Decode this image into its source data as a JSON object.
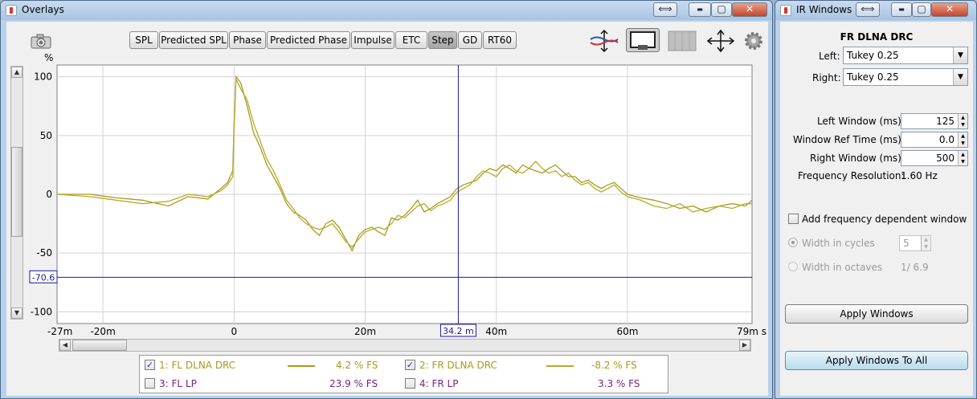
{
  "overlays_window": {
    "title": "Overlays",
    "controls": {
      "restore": "⟺",
      "minimize": "▬",
      "maximize": "▢",
      "close": "✕"
    },
    "tabs": [
      {
        "label": "SPL",
        "active": false
      },
      {
        "label": "Predicted SPL",
        "active": false
      },
      {
        "label": "Phase",
        "active": false
      },
      {
        "label": "Predicted Phase",
        "active": false
      },
      {
        "label": "Impulse",
        "active": false
      },
      {
        "label": "ETC",
        "active": false
      },
      {
        "label": "Step",
        "active": true
      },
      {
        "label": "GD",
        "active": false
      },
      {
        "label": "RT60",
        "active": false
      }
    ],
    "toolbar_icons": [
      "camera-icon",
      "arrange-traces-icon",
      "layout-icon",
      "stack-icon",
      "pan-icon",
      "gear-icon"
    ]
  },
  "chart_data": {
    "type": "line",
    "ylabel": "%",
    "y_ticks": [
      "100",
      "50",
      "0",
      "-50",
      "-100"
    ],
    "x_ticks": [
      "-27m",
      "-20m",
      "0",
      "20m",
      "40m",
      "60m",
      "79m s"
    ],
    "xlim": [
      -27,
      79
    ],
    "ylim": [
      -110,
      110
    ],
    "x_unit": "ms",
    "y_unit": "%",
    "grid": true,
    "cursor": {
      "x_label": "34.2 m",
      "x": 34.2,
      "y_label": "-70.6",
      "y": -70.6
    },
    "series": [
      {
        "name": "1: FL DLNA DRC",
        "color": "#a89a1e",
        "x": [
          -27,
          -22,
          -18,
          -14,
          -10,
          -7,
          -4,
          -2,
          -1,
          -0.2,
          0,
          0.3,
          1,
          2,
          3,
          4,
          5,
          6,
          7,
          8,
          9,
          10,
          11,
          12,
          13,
          14,
          15,
          16,
          17,
          18,
          19,
          20,
          21,
          22,
          23,
          24,
          25,
          26,
          27,
          28,
          29,
          30,
          31,
          32,
          33,
          34,
          35,
          36,
          37,
          38,
          39,
          40,
          41,
          42,
          43,
          44,
          45,
          46,
          47,
          48,
          49,
          50,
          51,
          52,
          53,
          54,
          55,
          56,
          57,
          58,
          59,
          60,
          62,
          64,
          66,
          68,
          70,
          72,
          74,
          76,
          78,
          79
        ],
        "y": [
          0,
          0,
          -3,
          -5,
          -10,
          -2,
          -4,
          5,
          10,
          20,
          60,
          100,
          95,
          75,
          52,
          40,
          25,
          15,
          5,
          -8,
          -15,
          -18,
          -22,
          -30,
          -35,
          -25,
          -22,
          -28,
          -38,
          -48,
          -35,
          -30,
          -28,
          -32,
          -35,
          -20,
          -22,
          -18,
          -12,
          -5,
          -15,
          -12,
          -8,
          -5,
          -2,
          5,
          8,
          10,
          12,
          18,
          22,
          20,
          25,
          22,
          18,
          25,
          22,
          20,
          18,
          22,
          25,
          20,
          15,
          15,
          10,
          12,
          8,
          5,
          8,
          10,
          5,
          0,
          -3,
          -5,
          -8,
          -12,
          -10,
          -15,
          -10,
          -8,
          -10,
          -5
        ]
      },
      {
        "name": "2: FR DLNA DRC",
        "color": "#b8aa28",
        "x": [
          -27,
          -22,
          -18,
          -14,
          -10,
          -7,
          -4,
          -2,
          -1,
          -0.2,
          0,
          0.3,
          1,
          2,
          3,
          4,
          5,
          6,
          7,
          8,
          9,
          10,
          11,
          12,
          13,
          14,
          15,
          16,
          17,
          18,
          19,
          20,
          21,
          22,
          23,
          24,
          25,
          26,
          27,
          28,
          29,
          30,
          31,
          32,
          33,
          34,
          35,
          36,
          37,
          38,
          39,
          40,
          41,
          42,
          43,
          44,
          45,
          46,
          47,
          48,
          49,
          50,
          51,
          52,
          53,
          54,
          55,
          56,
          57,
          58,
          59,
          60,
          62,
          64,
          66,
          68,
          70,
          72,
          74,
          76,
          78,
          79
        ],
        "y": [
          0,
          -2,
          -5,
          -8,
          -6,
          0,
          -2,
          3,
          8,
          15,
          55,
          98,
          90,
          80,
          60,
          45,
          30,
          20,
          8,
          -5,
          -12,
          -20,
          -25,
          -28,
          -30,
          -28,
          -25,
          -32,
          -40,
          -45,
          -38,
          -32,
          -30,
          -28,
          -30,
          -25,
          -18,
          -20,
          -15,
          -10,
          -8,
          -14,
          -10,
          -8,
          -5,
          2,
          5,
          8,
          15,
          20,
          18,
          15,
          22,
          25,
          20,
          18,
          22,
          28,
          22,
          18,
          20,
          15,
          18,
          12,
          8,
          10,
          5,
          2,
          5,
          8,
          2,
          -2,
          -5,
          -10,
          -12,
          -8,
          -15,
          -12,
          -10,
          -12,
          -8,
          -8
        ]
      }
    ]
  },
  "legend": {
    "items": [
      {
        "label": "1: FL DLNA DRC",
        "checked": true,
        "value": "4.2 % FS",
        "color": "#a89a1e",
        "show_line": true
      },
      {
        "label": "2: FR DLNA DRC",
        "checked": true,
        "value": "-8.2 % FS",
        "color": "#b8aa28",
        "show_line": true
      },
      {
        "label": "3: FL LP",
        "checked": false,
        "value": "23.9 % FS",
        "color": "#7a1f7a",
        "show_line": false
      },
      {
        "label": "4: FR LP",
        "checked": false,
        "value": "3.3 % FS",
        "color": "#7a1f7a",
        "show_line": false
      }
    ],
    "check_mark": "✓"
  },
  "ir_window": {
    "title": "IR Windows",
    "controls": {
      "restore": "⟺",
      "minimize": "▬",
      "maximize": "▢",
      "close": "✕"
    },
    "heading": "FR DLNA DRC",
    "left_label": "Left:",
    "left_value": "Tukey 0.25",
    "right_label": "Right:",
    "right_value": "Tukey 0.25",
    "dropdown_arrow": "▼",
    "left_window_label": "Left Window (ms):",
    "left_window_value": "125",
    "ref_time_label": "Window Ref Time (ms):",
    "ref_time_value": "0.0",
    "right_window_label": "Right Window (ms):",
    "right_window_value": "500",
    "freq_res_label": "Frequency Resolution:",
    "freq_res_value": "1.60 Hz",
    "add_freq_label": "Add frequency dependent window",
    "width_cycles_label": "Width in cycles",
    "width_cycles_value": "5",
    "width_octaves_label": "Width in octaves",
    "width_octaves_value": "1/ 6.9",
    "apply_label": "Apply Windows",
    "apply_all_label": "Apply Windows To All"
  }
}
